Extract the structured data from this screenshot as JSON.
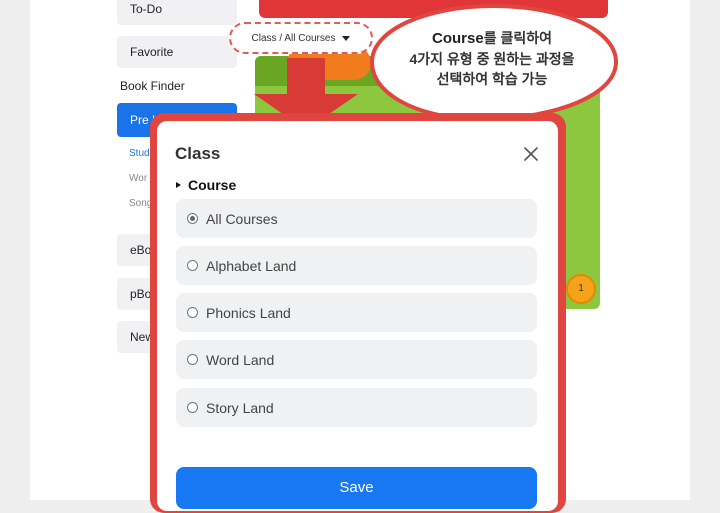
{
  "sidebar": {
    "items": [
      {
        "label": "To-Do"
      },
      {
        "label": "Favorite"
      }
    ],
    "heading": "Book Finder",
    "active": "Pre K",
    "subitems": [
      "Stud",
      "Wor",
      "Song"
    ],
    "lower_items": [
      "eBoo",
      "pBoo",
      "New"
    ]
  },
  "header": {
    "class_dropdown": "Class / All Courses"
  },
  "background": {
    "level_badge": "1"
  },
  "callout": {
    "line1_en": "Course",
    "line1_ko": "를 클릭하여",
    "line2": "4가지 유형 중 원하는 과정을",
    "line3": "선택하여 학습 가능"
  },
  "modal": {
    "title": "Class",
    "section_label": "Course",
    "options": [
      {
        "label": "All Courses",
        "selected": true
      },
      {
        "label": "Alphabet Land",
        "selected": false
      },
      {
        "label": "Phonics Land",
        "selected": false
      },
      {
        "label": "Word Land",
        "selected": false
      },
      {
        "label": "Story Land",
        "selected": false
      }
    ],
    "save_label": "Save"
  },
  "colors": {
    "accent_blue": "#1877f2",
    "frame_red": "#e0453f",
    "panel_green": "#8dc63f"
  }
}
